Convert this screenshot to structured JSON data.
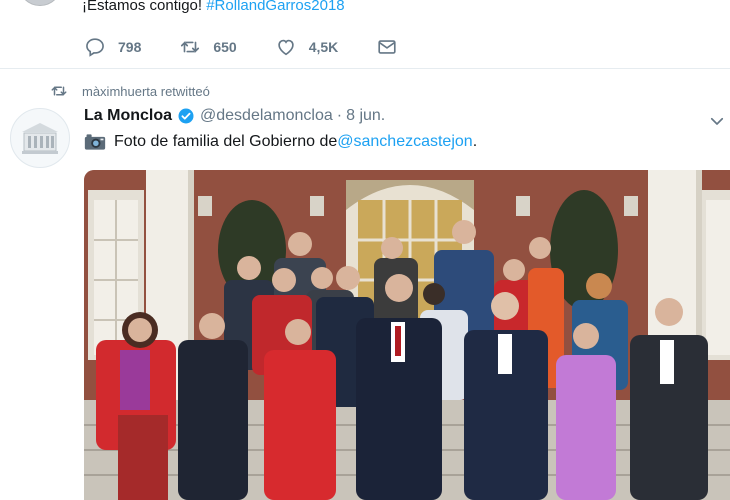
{
  "previous_tweet": {
    "text": "¡Estamos contigo! ",
    "hashtag": "#RollandGarros2018",
    "replies": "798",
    "retweets": "650",
    "likes": "4,5K"
  },
  "retweet_context": {
    "label": "màximhuerta retwitteó"
  },
  "tweet": {
    "name": "La Moncloa",
    "handle": "@desdelamoncloa",
    "separator": "·",
    "date": "8 jun.",
    "text": "Foto de familia del Gobierno de ",
    "mention": "@sanchezcastejon",
    "text_end": "."
  },
  "colors": {
    "accent": "#1da1f2",
    "muted": "#657786"
  },
  "icons": [
    "reply-icon",
    "retweet-icon",
    "like-icon",
    "message-icon",
    "verified-icon",
    "caret-down-icon",
    "camera-icon"
  ]
}
